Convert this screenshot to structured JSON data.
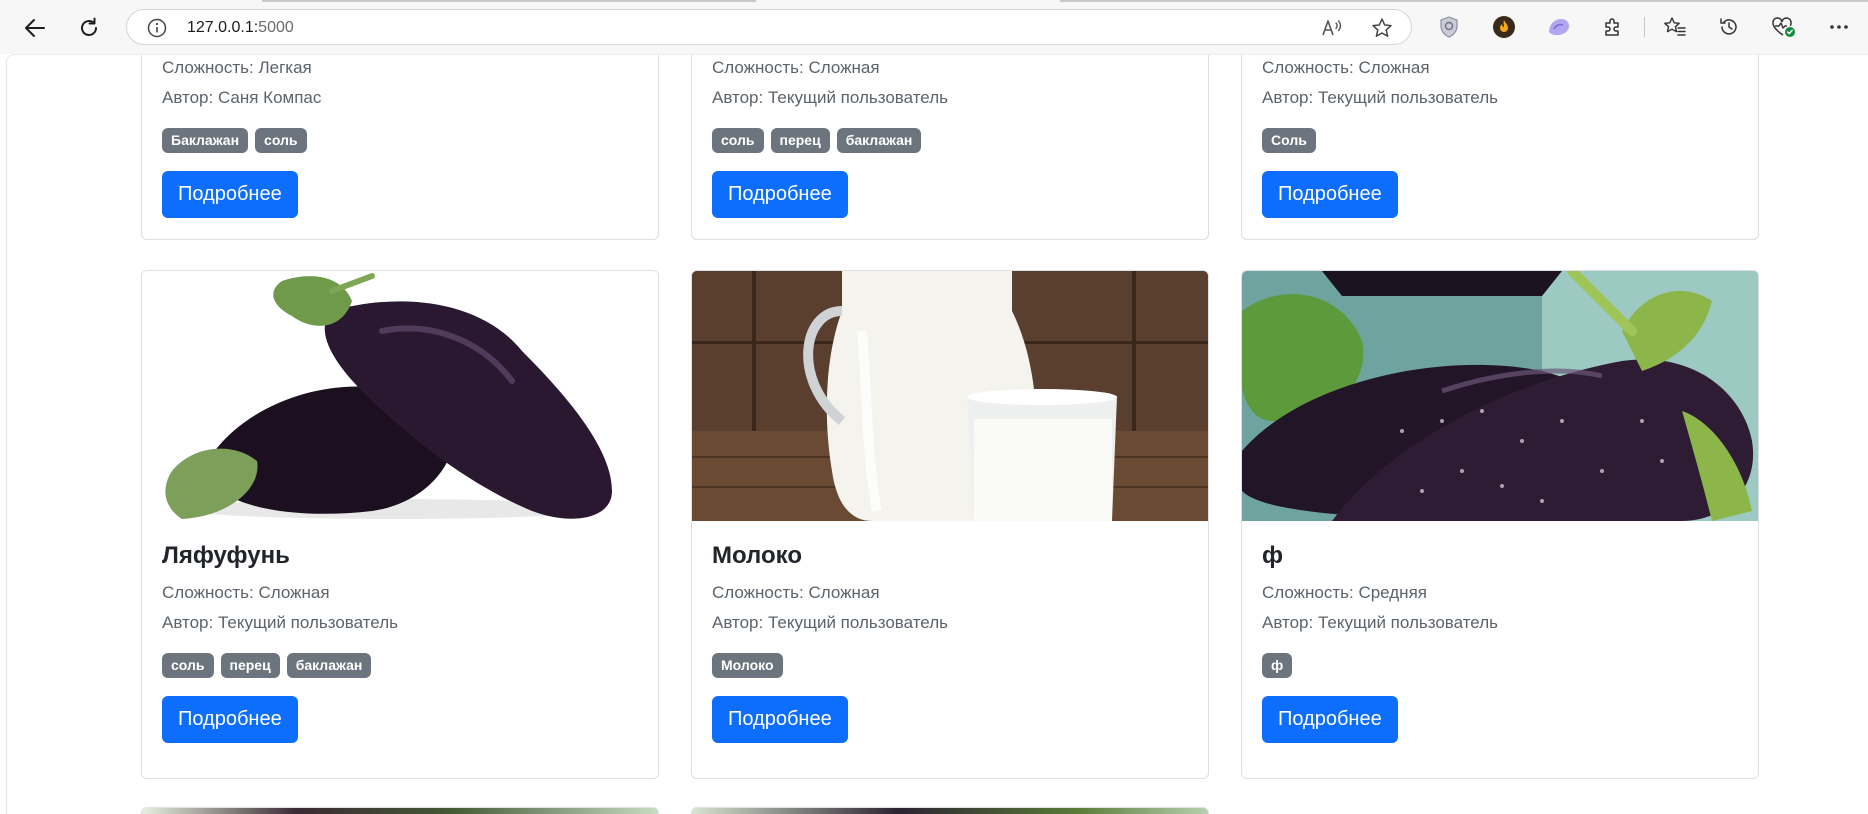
{
  "browser": {
    "url_host": "127.0.0.1:",
    "url_port": "5000"
  },
  "labels": {
    "complexity_prefix": "Сложность: ",
    "author_prefix": "Автор: ",
    "details_button": "Подробнее"
  },
  "top_cards": [
    {
      "complexity": "Сложность: Легкая",
      "author": "Автор: Саня Компас",
      "tags": [
        "Баклажан",
        "соль"
      ],
      "button": "Подробнее"
    },
    {
      "complexity": "Сложность: Сложная",
      "author": "Автор: Текущий пользователь",
      "tags": [
        "соль",
        "перец",
        "баклажан"
      ],
      "button": "Подробнее"
    },
    {
      "complexity": "Сложность: Сложная",
      "author": "Автор: Текущий пользователь",
      "tags": [
        "Соль"
      ],
      "button": "Подробнее"
    }
  ],
  "cards": [
    {
      "image": "eggplant-white-background",
      "title": "Ляфуфунь",
      "complexity": "Сложность: Сложная",
      "author": "Автор: Текущий пользователь",
      "tags": [
        "соль",
        "перец",
        "баклажан"
      ],
      "button": "Подробнее"
    },
    {
      "image": "milk-jug-and-glass",
      "title": "Молоко",
      "complexity": "Сложность: Сложная",
      "author": "Автор: Текущий пользователь",
      "tags": [
        "Молоко"
      ],
      "button": "Подробнее"
    },
    {
      "image": "wet-eggplants",
      "title": "ф",
      "complexity": "Сложность: Средняя",
      "author": "Автор: Текущий пользователь",
      "tags": [
        "ф"
      ],
      "button": "Подробнее"
    }
  ],
  "colors": {
    "primary": "#0d6efd",
    "badge": "#6c757d",
    "muted_text": "#5c636a"
  }
}
